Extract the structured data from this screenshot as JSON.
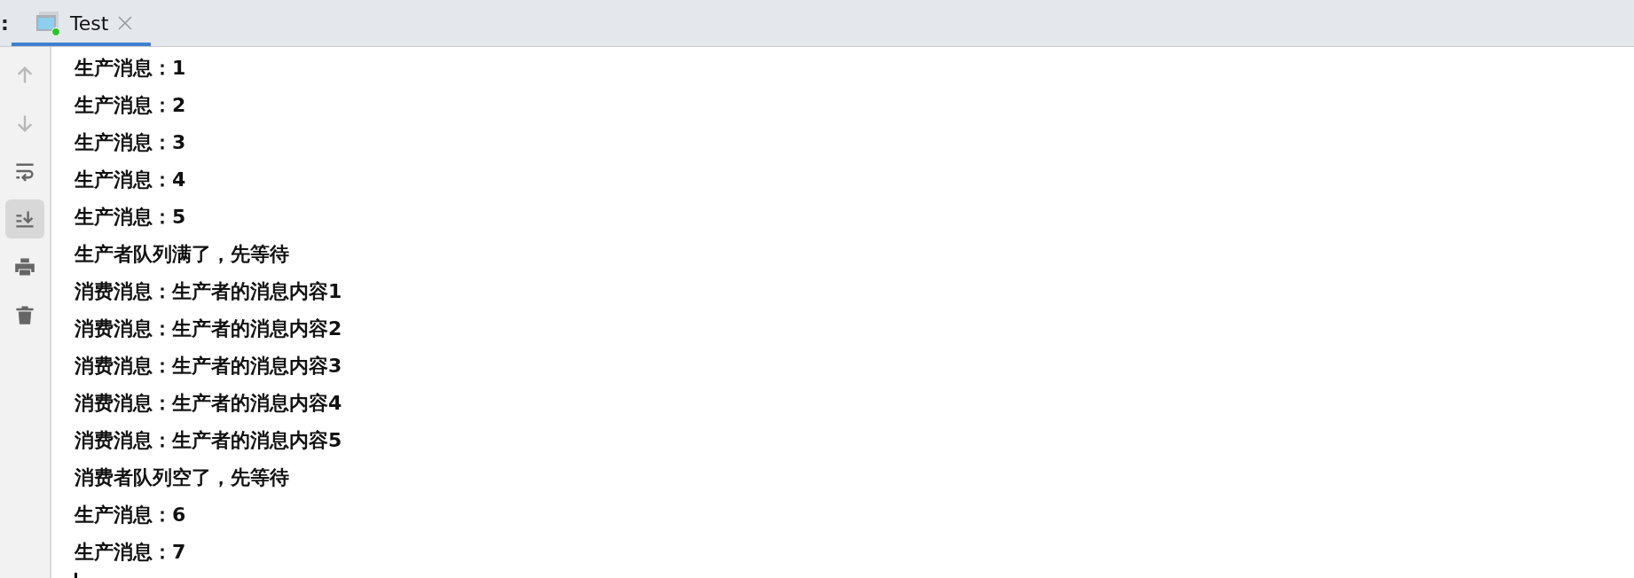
{
  "tab_bar": {
    "prefix": ":",
    "tabs": [
      {
        "label": "Test",
        "selected": true,
        "running": true
      }
    ]
  },
  "toolbar": [
    {
      "kind": "up",
      "disabled": true,
      "selected": false
    },
    {
      "kind": "down",
      "disabled": true,
      "selected": false
    },
    {
      "kind": "wrap",
      "disabled": false,
      "selected": false
    },
    {
      "kind": "scroll-end",
      "disabled": false,
      "selected": true
    },
    {
      "kind": "print",
      "disabled": false,
      "selected": false
    },
    {
      "kind": "trash",
      "disabled": false,
      "selected": false
    }
  ],
  "console": {
    "lines": [
      "生产消息：1",
      "生产消息：2",
      "生产消息：3",
      "生产消息：4",
      "生产消息：5",
      "生产者队列满了，先等待",
      "消费消息：生产者的消息内容1",
      "消费消息：生产者的消息内容2",
      "消费消息：生产者的消息内容3",
      "消费消息：生产者的消息内容4",
      "消费消息：生产者的消息内容5",
      "消费者队列空了，先等待",
      "生产消息：6",
      "生产消息：7"
    ],
    "caret": true
  }
}
